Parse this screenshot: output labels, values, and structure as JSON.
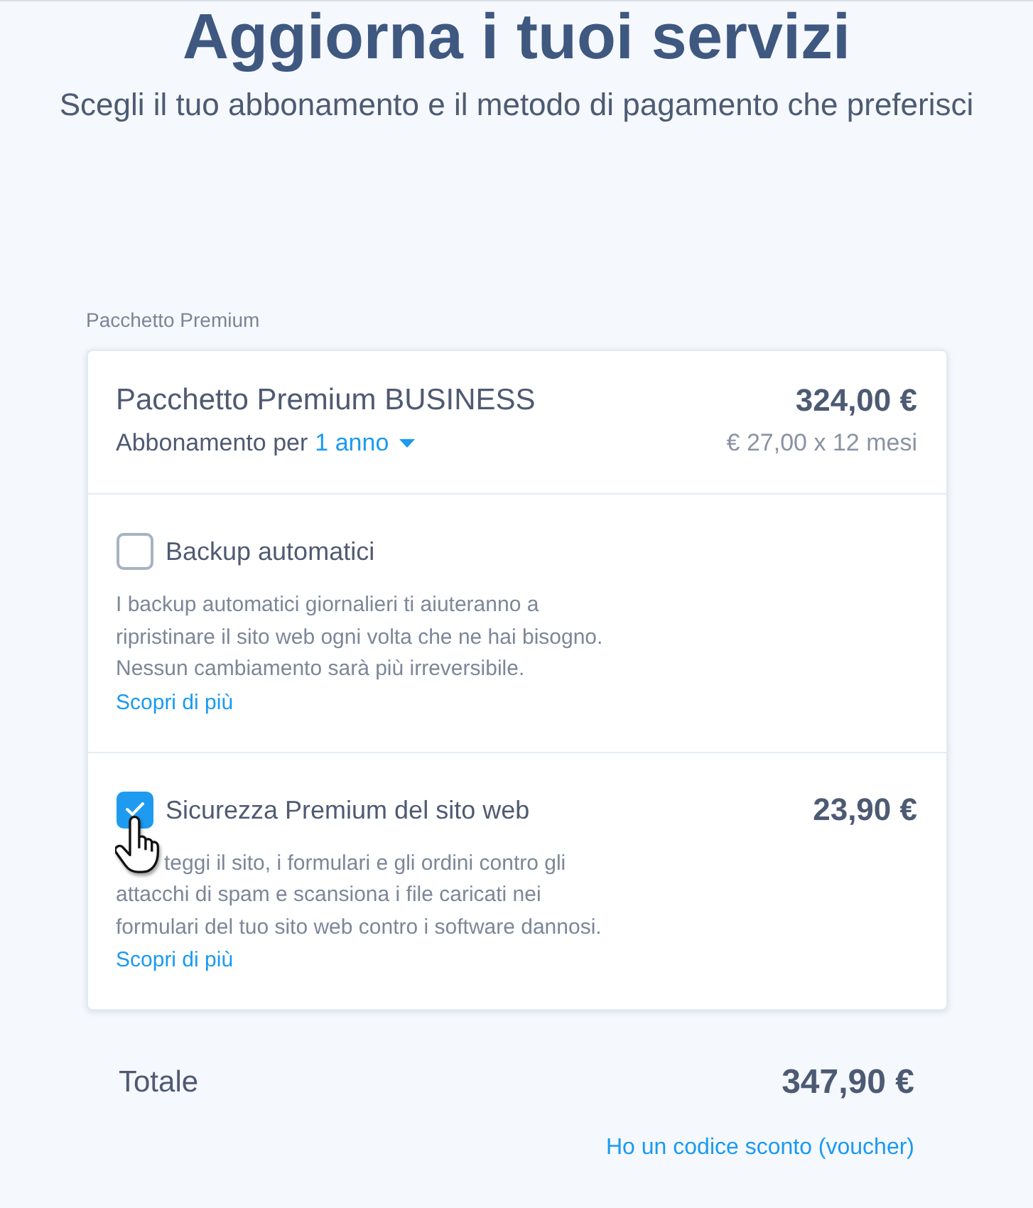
{
  "header": {
    "title": "Aggiorna i tuoi servizi",
    "subtitle": "Scegli il tuo abbonamento e il metodo di pagamento che preferisci"
  },
  "package": {
    "label": "Pacchetto Premium",
    "name": "Pacchetto Premium BUSINESS",
    "price": "324,00 €",
    "term_prefix": "Abbonamento per",
    "term": "1 anno",
    "monthly": "€ 27,00 x 12 mesi"
  },
  "options": [
    {
      "name": "Backup automatici",
      "checked": false,
      "cursor": false,
      "description": "I backup automatici giornalieri ti aiuteranno a ripristinare il sito web ogni volta che ne hai bisogno. Nessun cambiamento sarà più irreversibile.",
      "link": "Scopri di più"
    },
    {
      "name": "Sicurezza Premium del sito web",
      "checked": true,
      "cursor": true,
      "price": "23,90 €",
      "description": "teggi il sito, i formulari e gli ordini contro gli attacchi di spam e scansiona i file caricati nei formulari del tuo sito web contro i software dannosi.",
      "link": "Scopri di più"
    }
  ],
  "total": {
    "label": "Totale",
    "value": "347,90 €"
  },
  "voucher_link": "Ho un codice sconto (voucher)"
}
